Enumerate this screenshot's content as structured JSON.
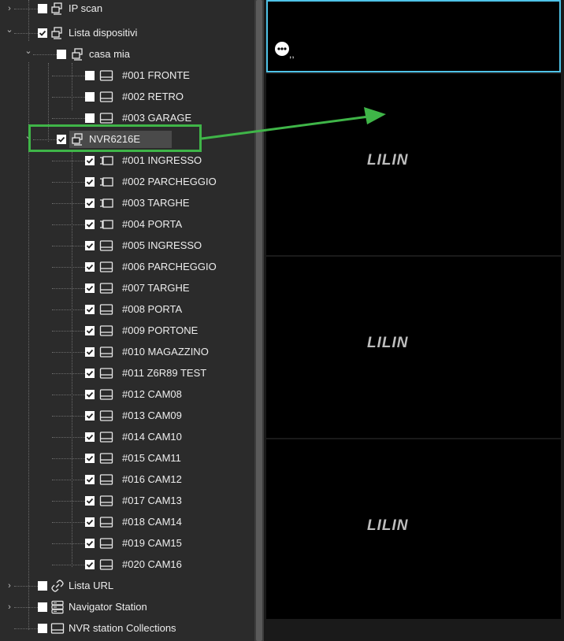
{
  "tree": {
    "items": [
      {
        "label": "IP scan",
        "checkbox": "unchecked",
        "icon": "network-group-icon",
        "chevron": ">"
      },
      {
        "label": "Lista dispositivi",
        "checkbox": "checked",
        "icon": "network-group-icon",
        "chevron": "v"
      },
      {
        "label": "casa mia",
        "checkbox": "unchecked",
        "icon": "network-group-icon",
        "chevron": "v"
      },
      {
        "label": "#001 FRONTE",
        "checkbox": "unchecked",
        "icon": "nvr-box-icon"
      },
      {
        "label": "#002 RETRO",
        "checkbox": "unchecked",
        "icon": "nvr-box-icon"
      },
      {
        "label": "#003 GARAGE",
        "checkbox": "unchecked",
        "icon": "nvr-box-icon"
      },
      {
        "label": "NVR6216E",
        "checkbox": "checked",
        "icon": "network-group-icon",
        "chevron": "v"
      },
      {
        "label": "#001 INGRESSO",
        "checkbox": "checked",
        "icon": "bullet-camera-icon"
      },
      {
        "label": "#002 PARCHEGGIO",
        "checkbox": "checked",
        "icon": "bullet-camera-icon"
      },
      {
        "label": "#003 TARGHE",
        "checkbox": "checked",
        "icon": "bullet-camera-icon"
      },
      {
        "label": "#004 PORTA",
        "checkbox": "checked",
        "icon": "bullet-camera-icon"
      },
      {
        "label": "#005 INGRESSO",
        "checkbox": "checked",
        "icon": "nvr-box-icon"
      },
      {
        "label": "#006 PARCHEGGIO",
        "checkbox": "checked",
        "icon": "nvr-box-icon"
      },
      {
        "label": "#007 TARGHE",
        "checkbox": "checked",
        "icon": "nvr-box-icon"
      },
      {
        "label": "#008 PORTA",
        "checkbox": "checked",
        "icon": "nvr-box-icon"
      },
      {
        "label": "#009 PORTONE",
        "checkbox": "checked",
        "icon": "nvr-box-icon"
      },
      {
        "label": "#010 MAGAZZINO",
        "checkbox": "checked",
        "icon": "nvr-box-icon"
      },
      {
        "label": "#011 Z6R89 TEST",
        "checkbox": "checked",
        "icon": "nvr-box-icon"
      },
      {
        "label": "#012 CAM08",
        "checkbox": "checked",
        "icon": "nvr-box-icon"
      },
      {
        "label": "#013 CAM09",
        "checkbox": "checked",
        "icon": "nvr-box-icon"
      },
      {
        "label": "#014 CAM10",
        "checkbox": "checked",
        "icon": "nvr-box-icon"
      },
      {
        "label": "#015 CAM11",
        "checkbox": "checked",
        "icon": "nvr-box-icon"
      },
      {
        "label": "#016 CAM12",
        "checkbox": "checked",
        "icon": "nvr-box-icon"
      },
      {
        "label": "#017 CAM13",
        "checkbox": "checked",
        "icon": "nvr-box-icon"
      },
      {
        "label": "#018 CAM14",
        "checkbox": "checked",
        "icon": "nvr-box-icon"
      },
      {
        "label": "#019 CAM15",
        "checkbox": "checked",
        "icon": "nvr-box-icon"
      },
      {
        "label": "#020 CAM16",
        "checkbox": "checked",
        "icon": "nvr-box-icon"
      },
      {
        "label": "Lista URL",
        "checkbox": "unchecked",
        "icon": "link-icon",
        "chevron": ">"
      },
      {
        "label": "Navigator Station",
        "checkbox": "unchecked",
        "icon": "server-rack-icon",
        "chevron": ">"
      },
      {
        "label": "NVR station Collections",
        "checkbox": "unchecked",
        "icon": "nvr-box-icon"
      }
    ]
  },
  "video_grid": {
    "cells": [
      {
        "logo": "",
        "selected": true,
        "overlay_icon": "chat-bubble-icon",
        "overlay_text": ",,"
      },
      {
        "logo": "LILIN",
        "selected": false
      },
      {
        "logo": "LILIN",
        "selected": false
      },
      {
        "logo": "LILIN",
        "selected": false
      }
    ]
  },
  "colors": {
    "callout": "#3fb548",
    "selection_border": "#4fc3e8",
    "tree_bg": "#2b2b2b",
    "video_bg": "#000000"
  }
}
